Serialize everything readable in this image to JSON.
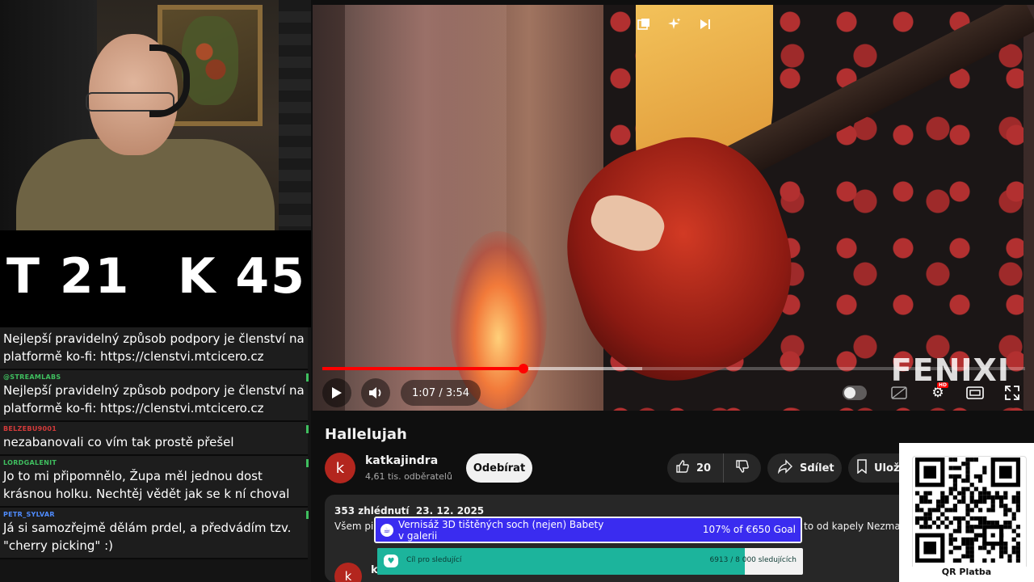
{
  "scoreboard": {
    "t": "T 21",
    "k": "K 45"
  },
  "chat": [
    {
      "user": "",
      "user_color": "#9146ff",
      "text": "Nejlepší pravidelný způsob podpory je členství na platformě ko-fi: https://clenstvi.mtcicero.cz"
    },
    {
      "user": "@STREAMLABS",
      "user_color": "#3fbf5f",
      "text": "Nejlepší pravidelný způsob podpory je členství na platformě ko-fi: https://clenstvi.mtcicero.cz"
    },
    {
      "user": "BELZEBU9001",
      "user_color": "#d43a3a",
      "text": "nezabanovali co vím tak prostě přešel"
    },
    {
      "user": "LORDGALENIT",
      "user_color": "#3fbf5f",
      "text": "Jo to mi připomnělo, Župa měl jednou dost krásnou holku. Nechtěj vědět jak se k ní choval"
    },
    {
      "user": "PETR_SYLVAR",
      "user_color": "#4f8cff",
      "text": "Já si samozřejmě dělám prdel, a předvádím tzv. \"cherry picking\" :)"
    }
  ],
  "video": {
    "watermark": "FENIXI",
    "time_current": "1:07",
    "time_sep": " / ",
    "time_total": "3:54",
    "progress_fraction": 0.286,
    "buffer_fraction": 0.455,
    "icons": {
      "miniplayer": "miniplayer-icon",
      "sparkle": "sparkle-icon",
      "next": "skip-next-icon"
    }
  },
  "video_title": "Hallelujah",
  "channel": {
    "avatar_letter": "k",
    "name": "katkajindra",
    "subscribers": "4,61 tis. odběratelů",
    "subscribe_label": "Odebírat"
  },
  "actions": {
    "likes": "20",
    "share": "Sdílet",
    "save": "Ulož"
  },
  "description": {
    "meta": "353 zhlédnutí  23. 12. 2025",
    "text_left": "Všem pi",
    "text_right": "to od kapely Nezmar",
    "comment_avatar_letter": "k",
    "comment_name": "ka"
  },
  "goal_donation": {
    "title": "Vernisáž 3D tištěných soch (nejen) Babety v galerii",
    "amount": "107% of €650 Goal",
    "fill_fraction": 1.0,
    "color": "#2a1cd6"
  },
  "goal_followers": {
    "title": "Cíl pro sledující",
    "amount": "6913 / 8 000 sledujících",
    "fill_fraction": 0.864,
    "color": "#1cb49c"
  },
  "qr": {
    "label": "QR Platba"
  }
}
